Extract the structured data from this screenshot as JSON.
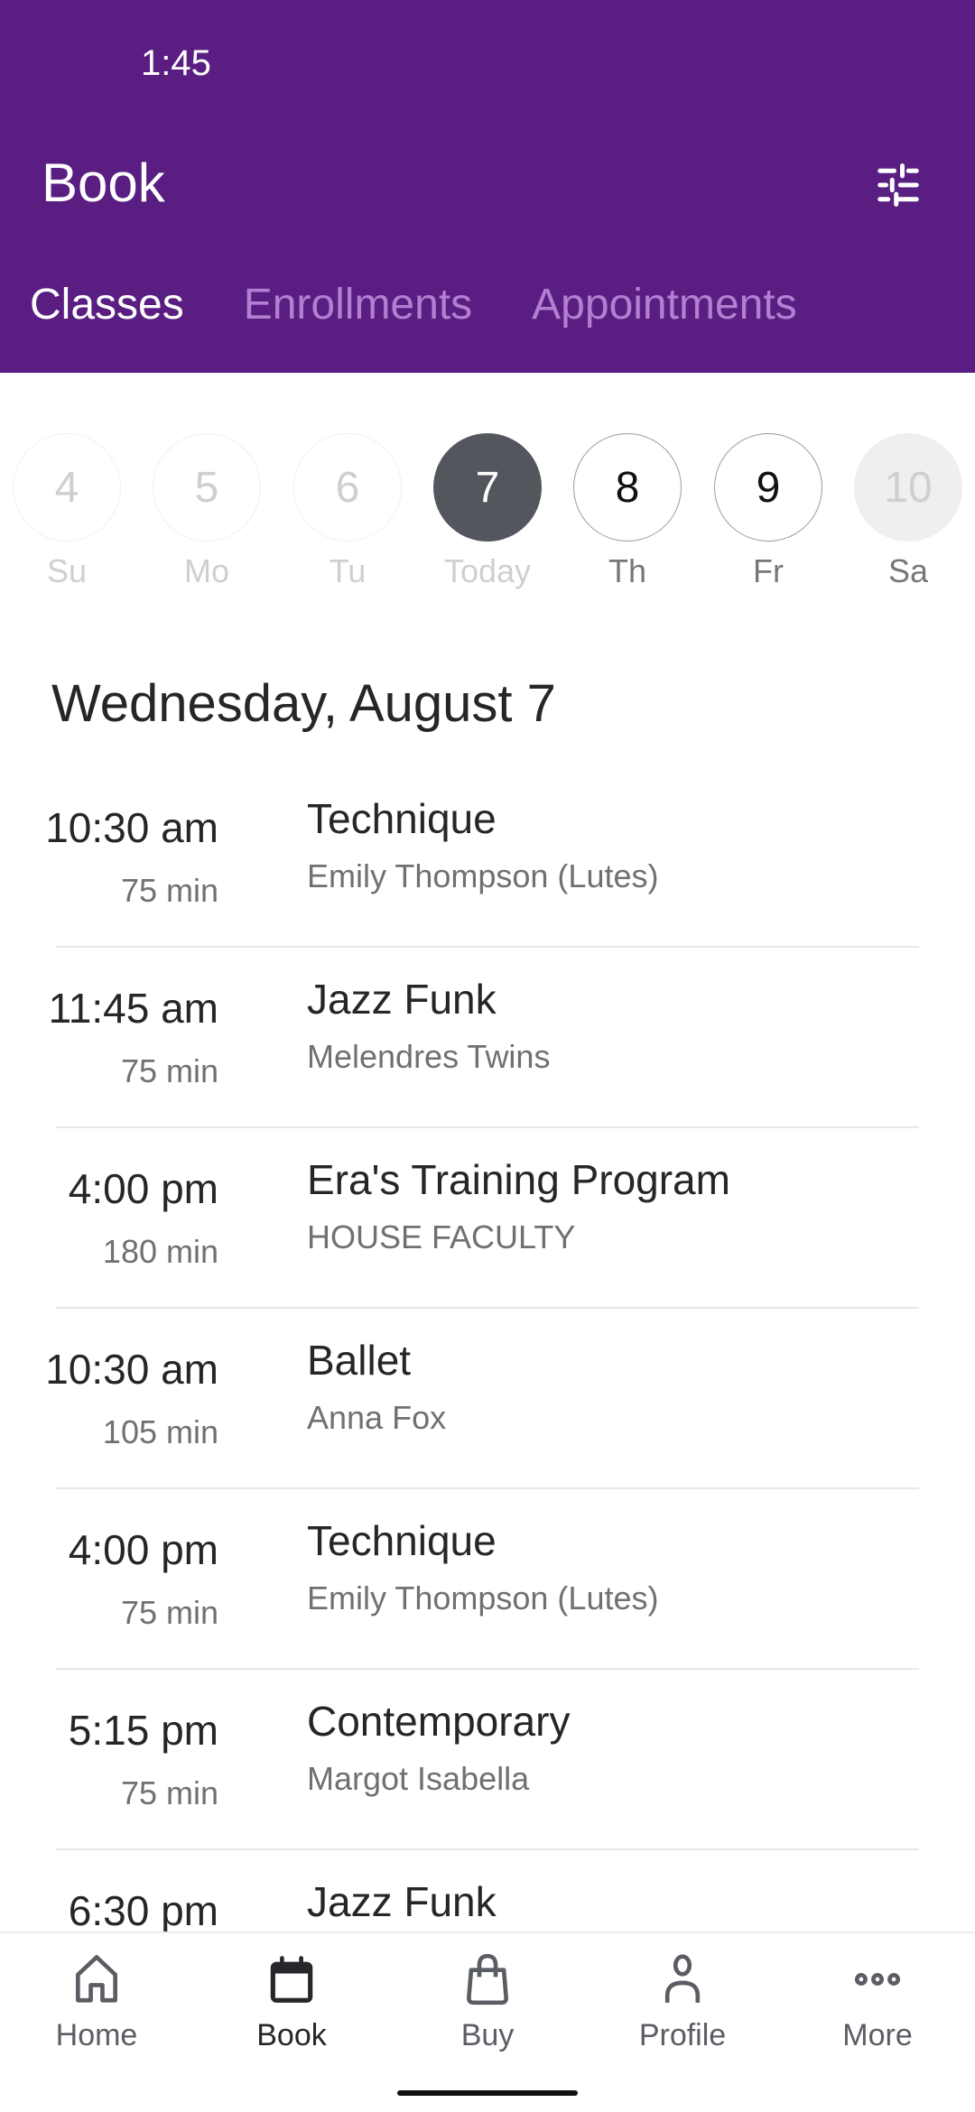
{
  "status_bar": {
    "time": "1:45"
  },
  "header": {
    "title": "Book",
    "filter_icon": "sliders-icon",
    "brand_color": "#5a1e82"
  },
  "tabs": [
    {
      "label": "Classes",
      "active": true
    },
    {
      "label": "Enrollments",
      "active": false
    },
    {
      "label": "Appointments",
      "active": false
    }
  ],
  "days": [
    {
      "number": "4",
      "label": "Su",
      "state": "past"
    },
    {
      "number": "5",
      "label": "Mo",
      "state": "past"
    },
    {
      "number": "6",
      "label": "Tu",
      "state": "past"
    },
    {
      "number": "7",
      "label": "Today",
      "state": "today"
    },
    {
      "number": "8",
      "label": "Th",
      "state": "future"
    },
    {
      "number": "9",
      "label": "Fr",
      "state": "future"
    },
    {
      "number": "10",
      "label": "Sa",
      "state": "disabled"
    }
  ],
  "date_heading": "Wednesday, August 7",
  "classes": [
    {
      "time": "10:30 am",
      "duration": "75 min",
      "name": "Technique",
      "instructor": "Emily Thompson (Lutes)"
    },
    {
      "time": "11:45 am",
      "duration": "75 min",
      "name": "Jazz Funk",
      "instructor": "Melendres Twins"
    },
    {
      "time": "4:00 pm",
      "duration": "180 min",
      "name": "Era's Training Program",
      "instructor": "HOUSE FACULTY"
    },
    {
      "time": "10:30 am",
      "duration": "105 min",
      "name": "Ballet",
      "instructor": "Anna Fox"
    },
    {
      "time": "4:00 pm",
      "duration": "75 min",
      "name": "Technique",
      "instructor": "Emily Thompson (Lutes)"
    },
    {
      "time": "5:15 pm",
      "duration": "75 min",
      "name": "Contemporary",
      "instructor": "Margot Isabella"
    },
    {
      "time": "6:30 pm",
      "duration": "",
      "name": "Jazz Funk",
      "instructor": ""
    }
  ],
  "bottom_nav": [
    {
      "label": "Home",
      "icon": "home-icon",
      "active": false
    },
    {
      "label": "Book",
      "icon": "calendar-icon",
      "active": true
    },
    {
      "label": "Buy",
      "icon": "shopping-bag-icon",
      "active": false
    },
    {
      "label": "Profile",
      "icon": "person-icon",
      "active": false
    },
    {
      "label": "More",
      "icon": "more-dots-icon",
      "active": false
    }
  ]
}
